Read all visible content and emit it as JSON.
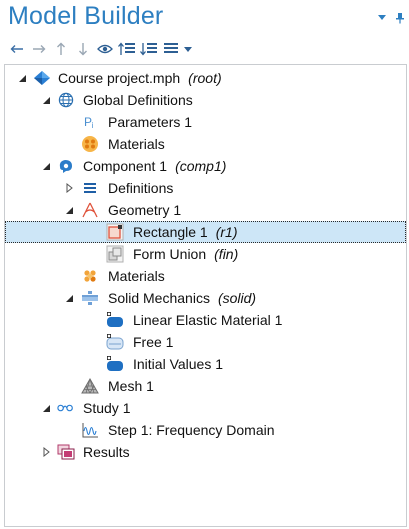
{
  "panel": {
    "title": "Model Builder",
    "accent_color": "#2d7fc1",
    "title_icons": [
      "pin-dropdown-icon",
      "pushpin-icon"
    ]
  },
  "toolbar": {
    "buttons": [
      {
        "icon": "arrow-left-icon"
      },
      {
        "icon": "arrow-right-icon"
      },
      {
        "icon": "arrow-up-icon"
      },
      {
        "icon": "arrow-down-icon"
      },
      {
        "icon": "eye-icon"
      },
      {
        "icon": "expand-sections-icon"
      },
      {
        "icon": "collapse-sections-icon"
      },
      {
        "icon": "list-view-icon"
      },
      {
        "icon": "dropdown-arrow-icon"
      }
    ]
  },
  "tree": {
    "items": [
      {
        "label": "Course project.mph",
        "tag": "(root)",
        "icon": "comsol-diamond-icon",
        "expander": "expanded"
      },
      {
        "label": "Global Definitions",
        "tag": "",
        "icon": "globe-icon",
        "expander": "expanded"
      },
      {
        "label": "Parameters 1",
        "tag": "",
        "icon": "parameters-pi-icon",
        "expander": "none"
      },
      {
        "label": "Materials",
        "tag": "",
        "icon": "materials-icon",
        "expander": "none"
      },
      {
        "label": "Component 1",
        "tag": "(comp1)",
        "icon": "component-icon",
        "expander": "expanded"
      },
      {
        "label": "Definitions",
        "tag": "",
        "icon": "definitions-icon",
        "expander": "collapsed"
      },
      {
        "label": "Geometry 1",
        "tag": "",
        "icon": "geometry-icon",
        "expander": "expanded"
      },
      {
        "label": "Rectangle 1",
        "tag": "(r1)",
        "icon": "rectangle-icon",
        "expander": "none",
        "selected": true
      },
      {
        "label": "Form Union",
        "tag": "(fin)",
        "icon": "form-union-icon",
        "expander": "none"
      },
      {
        "label": "Materials",
        "tag": "",
        "icon": "materials-icon",
        "expander": "none"
      },
      {
        "label": "Solid Mechanics",
        "tag": "(solid)",
        "icon": "solid-mechanics-icon",
        "expander": "expanded"
      },
      {
        "label": "Linear Elastic Material 1",
        "tag": "",
        "icon": "linear-elastic-icon",
        "expander": "none"
      },
      {
        "label": "Free 1",
        "tag": "",
        "icon": "free-boundary-icon",
        "expander": "none"
      },
      {
        "label": "Initial Values 1",
        "tag": "",
        "icon": "initial-values-icon",
        "expander": "none"
      },
      {
        "label": "Mesh 1",
        "tag": "",
        "icon": "mesh-icon",
        "expander": "none"
      },
      {
        "label": "Study 1",
        "tag": "",
        "icon": "study-icon",
        "expander": "expanded"
      },
      {
        "label": "Step 1: Frequency Domain",
        "tag": "",
        "icon": "frequency-domain-icon",
        "expander": "none"
      },
      {
        "label": "Results",
        "tag": "",
        "icon": "results-icon",
        "expander": "collapsed"
      }
    ]
  }
}
